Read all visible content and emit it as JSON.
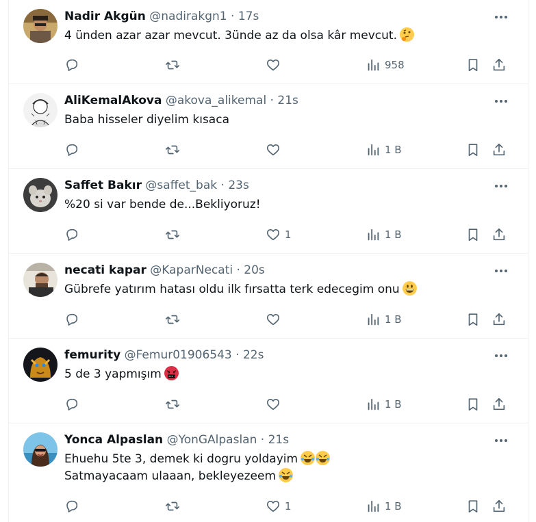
{
  "colors": {
    "text": "#0f1419",
    "muted": "#536471",
    "border": "#eff3f4"
  },
  "tweets": [
    {
      "name": "Nadir Akgün",
      "handle": "@nadirakgn1",
      "dot": " · ",
      "time": "17s",
      "lines": [
        "4 ünden azar azar mevcut. 3ünde az da olsa kâr mevcut."
      ],
      "emoji": [
        "thinking-face"
      ],
      "replies": "",
      "retweets": "",
      "likes": "",
      "views": "958"
    },
    {
      "name": "AliKemalAkova",
      "handle": "@akova_alikemal",
      "dot": " · ",
      "time": "21s",
      "lines": [
        "Baba hisseler diyelim kısaca"
      ],
      "emoji": [],
      "replies": "",
      "retweets": "",
      "likes": "",
      "views": "1 B"
    },
    {
      "name": "Saffet Bakır",
      "handle": "@saffet_bak",
      "dot": " · ",
      "time": "23s",
      "lines": [
        "%20 si var bende de...Bekliyoruz!"
      ],
      "emoji": [],
      "replies": "",
      "retweets": "",
      "likes": "1",
      "views": "1 B"
    },
    {
      "name": "necati kapar",
      "handle": "@KaparNecati",
      "dot": " · ",
      "time": "20s",
      "lines": [
        "Gübrefe yatırım hatası oldu ilk fırsatta terk edecegim onu"
      ],
      "emoji": [
        "grinning-face"
      ],
      "replies": "",
      "retweets": "",
      "likes": "",
      "views": "1 B"
    },
    {
      "name": "femurity",
      "handle": "@Femur01906543",
      "dot": " · ",
      "time": "22s",
      "lines": [
        "5 de 3 yapmışım"
      ],
      "emoji": [
        "cursing-face"
      ],
      "replies": "",
      "retweets": "",
      "likes": "",
      "views": "1 B"
    },
    {
      "name": "Yonca Alpaslan",
      "handle": "@YonGAlpaslan",
      "dot": " · ",
      "time": "21s",
      "lines": [
        "Ehuehu 5te 3, demek ki dogru yoldayim",
        "Satmayacaam ulaaan, bekleyezeem"
      ],
      "emoji": [
        "rolling-laughing-face"
      ],
      "replies": "",
      "retweets": "",
      "likes": "1",
      "views": "1 B"
    }
  ]
}
